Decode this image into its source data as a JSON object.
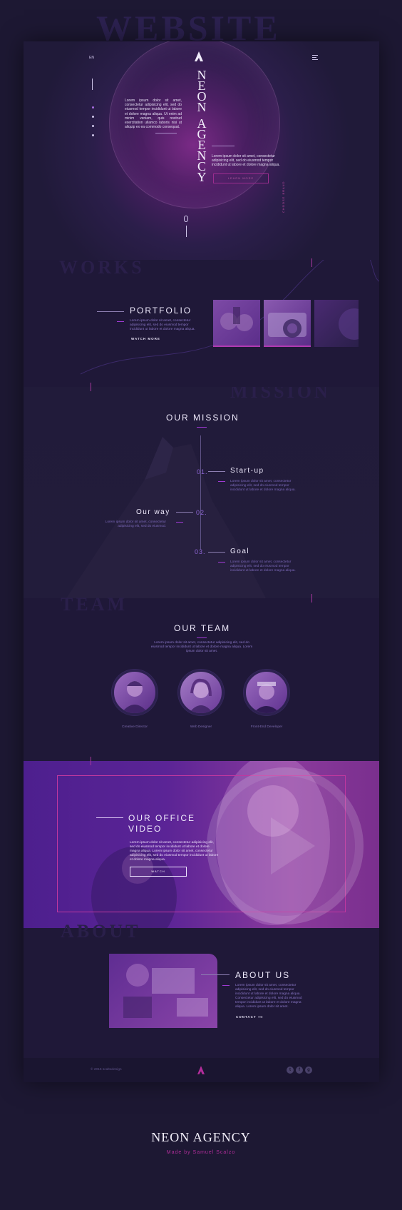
{
  "ghost_words": {
    "website": "WEBSITE",
    "works": "WORKS",
    "mission": "MISSION",
    "team": "TEAM",
    "about": "ABOUT"
  },
  "header": {
    "lang": "EN",
    "brand": "NEON AGENCY",
    "menu_icon": "hamburger-icon",
    "logo_icon": "triangle-logo-icon"
  },
  "hero": {
    "left_text": "Lorem ipsum dolor sit amet, consectetur adipisicing elit, sed do eiusmod tempor incididunt ut labore et dolore magna aliqua. Ut enim ad minim veniam, quis nostrud exercitation ullamco laboris nisi ut aliquip ex ea commodo consequat.",
    "right_text": "Lorem ipsum dolor sit amet, consectetur adipisicing elit, sed do eiusmod tempor incididunt ut labore et dolore magna aliqua.",
    "button": "LEARN MORE",
    "side_tag": "CHOOSE BRAND",
    "nav_dots": 4,
    "active_dot": 0
  },
  "portfolio": {
    "title": "PORTFOLIO",
    "text": "Lorem ipsum dolor sit amet, consectetur adipisicing elit, sed do eiusmod tempor incididunt ut labore et dolore magna aliqua.",
    "link": "WATCH MORE"
  },
  "mission": {
    "title": "OUR MISSION",
    "steps": [
      {
        "num": "01.",
        "title": "Start-up",
        "text": "Lorem ipsum dolor sit amet, consectetur adipisicing elit, sed do eiusmod tempor incididunt ut labore et dolore magna aliqua."
      },
      {
        "num": "02.",
        "title": "Our way",
        "text": "Lorem ipsum dolor sit amet, consectetur adipisicing elit, sed do eiusmod."
      },
      {
        "num": "03.",
        "title": "Goal",
        "text": "Lorem ipsum dolor sit amet, consectetur adipisicing elit, sed do eiusmod tempor incididunt ut labore et dolore magna aliqua."
      }
    ]
  },
  "team": {
    "title": "OUR TEAM",
    "text": "Lorem ipsum dolor sit amet, consectetur adipisicing elit, sed do eiusmod tempor incididunt ut labore et dolore magna aliqua. Lorem ipsum dolor sit amet.",
    "members": [
      {
        "role": "Creative Director"
      },
      {
        "role": "Web Designer"
      },
      {
        "role": "Front-End Developer"
      }
    ]
  },
  "video": {
    "title_line1": "OUR OFFICE",
    "title_line2": "VIDEO",
    "text": "Lorem ipsum dolor sit amet, consectetur adipisicing elit, sed do eiusmod tempor incididunt ut labore et dolore magna aliqua. Lorem ipsum dolor sit amet, consectetur adipisicing elit, sed do eiusmod tempor incididunt ut labore et dolore magna aliqua.",
    "button": "WATCH"
  },
  "about": {
    "title": "ABOUT US",
    "text": "Lorem ipsum dolor sit amet, consectetur adipisicing elit, sed do eiusmod tempor incididunt ut labore et dolore magna aliqua. Consectetur adipisicing elit, sed do eiusmod tempor incididunt ut labore et dolore magna aliqua. Lorem ipsum dolor sit amet.",
    "link": "CONTACT ⟶"
  },
  "footer": {
    "copyright": "© 2016 scaltodesign",
    "social": [
      "t",
      "f",
      "g"
    ]
  },
  "showcase": {
    "title": "NEON AGENCY",
    "credit": "Made by Samuel Scalzo"
  },
  "colors": {
    "bg": "#1d1833",
    "accent_magenta": "#b22d9b",
    "accent_violet": "#8e66d6"
  }
}
